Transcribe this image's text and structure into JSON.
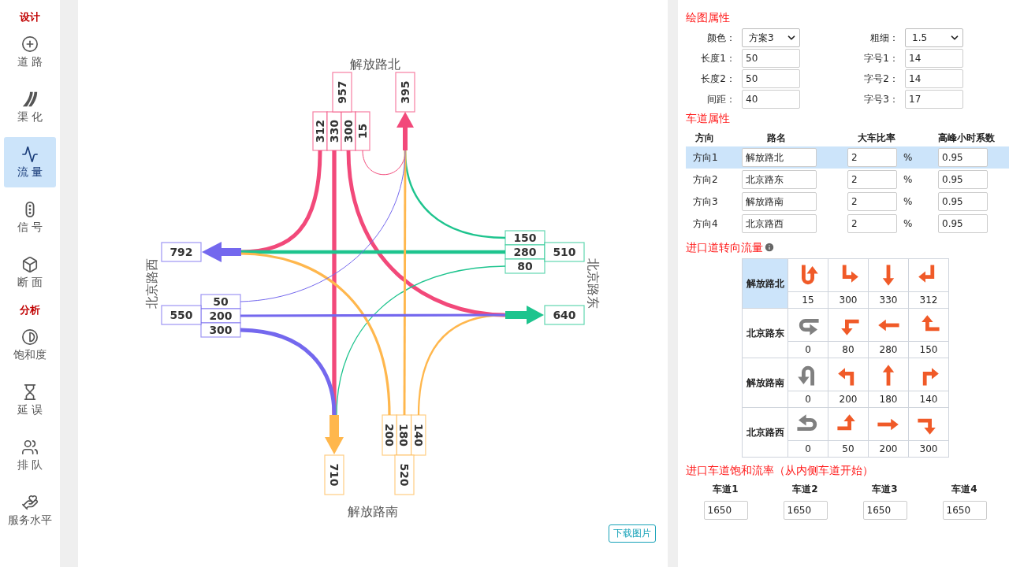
{
  "sidebar": {
    "sections": [
      {
        "title": "设计",
        "items": [
          {
            "label": "道 路",
            "kind": "road",
            "selected": false
          },
          {
            "label": "渠 化",
            "kind": "channel",
            "selected": false
          },
          {
            "label": "流 量",
            "kind": "flow",
            "selected": true
          },
          {
            "label": "信 号",
            "kind": "signal",
            "selected": false
          },
          {
            "label": "断 面",
            "kind": "section",
            "selected": false
          }
        ]
      },
      {
        "title": "分析",
        "items": [
          {
            "label": "饱和度",
            "kind": "saturation",
            "selected": false
          },
          {
            "label": "延 误",
            "kind": "delay",
            "selected": false
          },
          {
            "label": "排 队",
            "kind": "queue",
            "selected": false
          },
          {
            "label": "服务水平",
            "kind": "service",
            "selected": false
          }
        ]
      }
    ]
  },
  "diagram": {
    "approaches": [
      {
        "name": "解放路北",
        "color": "#f2497a",
        "in_total": "957",
        "out_total": "395",
        "lanes": [
          {
            "kind": "right",
            "value": "312"
          },
          {
            "kind": "straight",
            "value": "330"
          },
          {
            "kind": "left",
            "value": "300"
          },
          {
            "kind": "uturn",
            "value": "15"
          }
        ]
      },
      {
        "name": "北京路东",
        "color": "#1ec48e",
        "in_total": "510",
        "out_total": "640",
        "lanes": [
          {
            "kind": "right",
            "value": "150"
          },
          {
            "kind": "straight",
            "value": "280"
          },
          {
            "kind": "left",
            "value": "80"
          }
        ]
      },
      {
        "name": "解放路南",
        "color": "#ffb74d",
        "in_total": "520",
        "out_total": "710",
        "lanes": [
          {
            "kind": "left",
            "value": "200"
          },
          {
            "kind": "straight",
            "value": "180"
          },
          {
            "kind": "right",
            "value": "140"
          }
        ]
      },
      {
        "name": "北京路西",
        "color": "#7468ee",
        "in_total": "550",
        "out_total": "792",
        "lanes": [
          {
            "kind": "left",
            "value": "50"
          },
          {
            "kind": "straight",
            "value": "200"
          },
          {
            "kind": "right",
            "value": "300"
          }
        ]
      }
    ],
    "download_button": "下载图片"
  },
  "drawing_props": {
    "title": "绘图属性",
    "fields": [
      {
        "label": "颜色：",
        "value": "方案3",
        "kind": "select"
      },
      {
        "label": "粗细：",
        "value": "1.5",
        "kind": "select"
      },
      {
        "label": "长度1：",
        "value": "50",
        "kind": "input"
      },
      {
        "label": "字号1：",
        "value": "14",
        "kind": "input"
      },
      {
        "label": "长度2：",
        "value": "50",
        "kind": "input"
      },
      {
        "label": "字号2：",
        "value": "14",
        "kind": "input"
      },
      {
        "label": "间距：",
        "value": "40",
        "kind": "input"
      },
      {
        "label": "字号3：",
        "value": "17",
        "kind": "input"
      }
    ]
  },
  "lane_props": {
    "title": "车道属性",
    "columns": [
      "方向",
      "路名",
      "大车比率",
      "高峰小时系数"
    ],
    "rows": [
      {
        "direction": "方向1",
        "road": "解放路北",
        "ratio": "2",
        "unit": "%",
        "factor": "0.95",
        "selected": true
      },
      {
        "direction": "方向2",
        "road": "北京路东",
        "ratio": "2",
        "unit": "%",
        "factor": "0.95",
        "selected": false
      },
      {
        "direction": "方向3",
        "road": "解放路南",
        "ratio": "2",
        "unit": "%",
        "factor": "0.95",
        "selected": false
      },
      {
        "direction": "方向4",
        "road": "北京路西",
        "ratio": "2",
        "unit": "%",
        "factor": "0.95",
        "selected": false
      }
    ]
  },
  "turn_flows": {
    "title": "进口道转向流量",
    "approaches": [
      {
        "name": "解放路北",
        "selected": true,
        "movements": [
          {
            "kind": "uturn",
            "value": "15",
            "disabled": false
          },
          {
            "kind": "left",
            "value": "300",
            "disabled": false
          },
          {
            "kind": "straight",
            "value": "330",
            "disabled": false
          },
          {
            "kind": "right",
            "value": "312",
            "disabled": false
          }
        ]
      },
      {
        "name": "北京路东",
        "selected": false,
        "movements": [
          {
            "kind": "uturn",
            "value": "0",
            "disabled": true
          },
          {
            "kind": "left",
            "value": "80",
            "disabled": false
          },
          {
            "kind": "straight",
            "value": "280",
            "disabled": false
          },
          {
            "kind": "right",
            "value": "150",
            "disabled": false
          }
        ]
      },
      {
        "name": "解放路南",
        "selected": false,
        "movements": [
          {
            "kind": "uturn",
            "value": "0",
            "disabled": true
          },
          {
            "kind": "left",
            "value": "200",
            "disabled": false
          },
          {
            "kind": "straight",
            "value": "180",
            "disabled": false
          },
          {
            "kind": "right",
            "value": "140",
            "disabled": false
          }
        ]
      },
      {
        "name": "北京路西",
        "selected": false,
        "movements": [
          {
            "kind": "uturn",
            "value": "0",
            "disabled": true
          },
          {
            "kind": "left",
            "value": "50",
            "disabled": false
          },
          {
            "kind": "straight",
            "value": "200",
            "disabled": false
          },
          {
            "kind": "right",
            "value": "300",
            "disabled": false
          }
        ]
      }
    ]
  },
  "saturation": {
    "title": "进口车道饱和流率（从内侧车道开始）",
    "lanes": [
      {
        "label": "车道1",
        "value": "1650"
      },
      {
        "label": "车道2",
        "value": "1650"
      },
      {
        "label": "车道3",
        "value": "1650"
      },
      {
        "label": "车道4",
        "value": "1650"
      }
    ]
  }
}
